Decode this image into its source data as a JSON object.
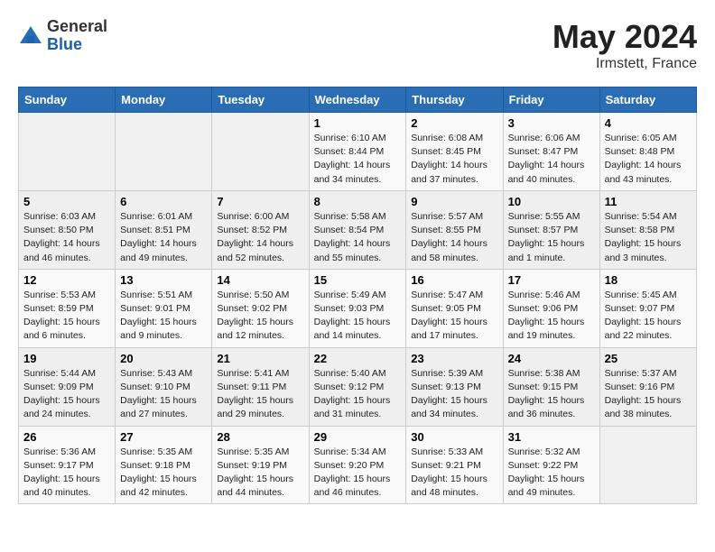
{
  "header": {
    "logo_general": "General",
    "logo_blue": "Blue",
    "title": "May 2024",
    "location": "Irmstett, France"
  },
  "weekdays": [
    "Sunday",
    "Monday",
    "Tuesday",
    "Wednesday",
    "Thursday",
    "Friday",
    "Saturday"
  ],
  "weeks": [
    [
      {
        "day": "",
        "info": ""
      },
      {
        "day": "",
        "info": ""
      },
      {
        "day": "",
        "info": ""
      },
      {
        "day": "1",
        "info": "Sunrise: 6:10 AM\nSunset: 8:44 PM\nDaylight: 14 hours\nand 34 minutes."
      },
      {
        "day": "2",
        "info": "Sunrise: 6:08 AM\nSunset: 8:45 PM\nDaylight: 14 hours\nand 37 minutes."
      },
      {
        "day": "3",
        "info": "Sunrise: 6:06 AM\nSunset: 8:47 PM\nDaylight: 14 hours\nand 40 minutes."
      },
      {
        "day": "4",
        "info": "Sunrise: 6:05 AM\nSunset: 8:48 PM\nDaylight: 14 hours\nand 43 minutes."
      }
    ],
    [
      {
        "day": "5",
        "info": "Sunrise: 6:03 AM\nSunset: 8:50 PM\nDaylight: 14 hours\nand 46 minutes."
      },
      {
        "day": "6",
        "info": "Sunrise: 6:01 AM\nSunset: 8:51 PM\nDaylight: 14 hours\nand 49 minutes."
      },
      {
        "day": "7",
        "info": "Sunrise: 6:00 AM\nSunset: 8:52 PM\nDaylight: 14 hours\nand 52 minutes."
      },
      {
        "day": "8",
        "info": "Sunrise: 5:58 AM\nSunset: 8:54 PM\nDaylight: 14 hours\nand 55 minutes."
      },
      {
        "day": "9",
        "info": "Sunrise: 5:57 AM\nSunset: 8:55 PM\nDaylight: 14 hours\nand 58 minutes."
      },
      {
        "day": "10",
        "info": "Sunrise: 5:55 AM\nSunset: 8:57 PM\nDaylight: 15 hours\nand 1 minute."
      },
      {
        "day": "11",
        "info": "Sunrise: 5:54 AM\nSunset: 8:58 PM\nDaylight: 15 hours\nand 3 minutes."
      }
    ],
    [
      {
        "day": "12",
        "info": "Sunrise: 5:53 AM\nSunset: 8:59 PM\nDaylight: 15 hours\nand 6 minutes."
      },
      {
        "day": "13",
        "info": "Sunrise: 5:51 AM\nSunset: 9:01 PM\nDaylight: 15 hours\nand 9 minutes."
      },
      {
        "day": "14",
        "info": "Sunrise: 5:50 AM\nSunset: 9:02 PM\nDaylight: 15 hours\nand 12 minutes."
      },
      {
        "day": "15",
        "info": "Sunrise: 5:49 AM\nSunset: 9:03 PM\nDaylight: 15 hours\nand 14 minutes."
      },
      {
        "day": "16",
        "info": "Sunrise: 5:47 AM\nSunset: 9:05 PM\nDaylight: 15 hours\nand 17 minutes."
      },
      {
        "day": "17",
        "info": "Sunrise: 5:46 AM\nSunset: 9:06 PM\nDaylight: 15 hours\nand 19 minutes."
      },
      {
        "day": "18",
        "info": "Sunrise: 5:45 AM\nSunset: 9:07 PM\nDaylight: 15 hours\nand 22 minutes."
      }
    ],
    [
      {
        "day": "19",
        "info": "Sunrise: 5:44 AM\nSunset: 9:09 PM\nDaylight: 15 hours\nand 24 minutes."
      },
      {
        "day": "20",
        "info": "Sunrise: 5:43 AM\nSunset: 9:10 PM\nDaylight: 15 hours\nand 27 minutes."
      },
      {
        "day": "21",
        "info": "Sunrise: 5:41 AM\nSunset: 9:11 PM\nDaylight: 15 hours\nand 29 minutes."
      },
      {
        "day": "22",
        "info": "Sunrise: 5:40 AM\nSunset: 9:12 PM\nDaylight: 15 hours\nand 31 minutes."
      },
      {
        "day": "23",
        "info": "Sunrise: 5:39 AM\nSunset: 9:13 PM\nDaylight: 15 hours\nand 34 minutes."
      },
      {
        "day": "24",
        "info": "Sunrise: 5:38 AM\nSunset: 9:15 PM\nDaylight: 15 hours\nand 36 minutes."
      },
      {
        "day": "25",
        "info": "Sunrise: 5:37 AM\nSunset: 9:16 PM\nDaylight: 15 hours\nand 38 minutes."
      }
    ],
    [
      {
        "day": "26",
        "info": "Sunrise: 5:36 AM\nSunset: 9:17 PM\nDaylight: 15 hours\nand 40 minutes."
      },
      {
        "day": "27",
        "info": "Sunrise: 5:35 AM\nSunset: 9:18 PM\nDaylight: 15 hours\nand 42 minutes."
      },
      {
        "day": "28",
        "info": "Sunrise: 5:35 AM\nSunset: 9:19 PM\nDaylight: 15 hours\nand 44 minutes."
      },
      {
        "day": "29",
        "info": "Sunrise: 5:34 AM\nSunset: 9:20 PM\nDaylight: 15 hours\nand 46 minutes."
      },
      {
        "day": "30",
        "info": "Sunrise: 5:33 AM\nSunset: 9:21 PM\nDaylight: 15 hours\nand 48 minutes."
      },
      {
        "day": "31",
        "info": "Sunrise: 5:32 AM\nSunset: 9:22 PM\nDaylight: 15 hours\nand 49 minutes."
      },
      {
        "day": "",
        "info": ""
      }
    ]
  ]
}
